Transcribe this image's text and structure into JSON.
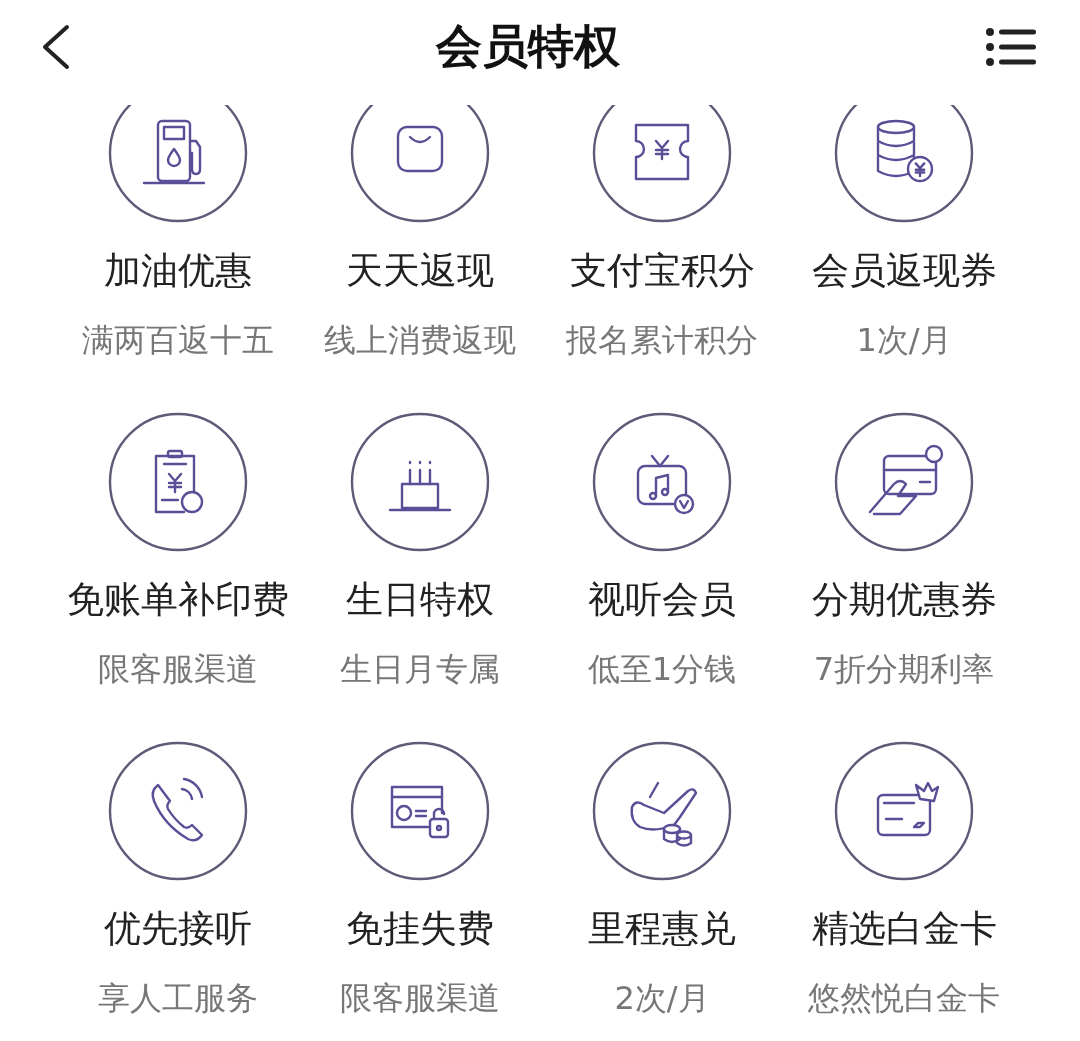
{
  "header": {
    "title": "会员特权"
  },
  "privileges": [
    {
      "name": "加油优惠",
      "note": "满两百返十五"
    },
    {
      "name": "天天返现",
      "note": "线上消费返现"
    },
    {
      "name": "支付宝积分",
      "note": "报名累计积分"
    },
    {
      "name": "会员返现券",
      "note": "1次/月"
    },
    {
      "name": "免账单补印费",
      "note": "限客服渠道"
    },
    {
      "name": "生日特权",
      "note": "生日月专属"
    },
    {
      "name": "视听会员",
      "note": "低至1分钱"
    },
    {
      "name": "分期优惠券",
      "note": "7折分期利率"
    },
    {
      "name": "优先接听",
      "note": "享人工服务"
    },
    {
      "name": "免挂失费",
      "note": "限客服渠道"
    },
    {
      "name": "里程惠兑",
      "note": "2次/月"
    },
    {
      "name": "精选白金卡",
      "note": "悠然悦白金卡"
    }
  ]
}
